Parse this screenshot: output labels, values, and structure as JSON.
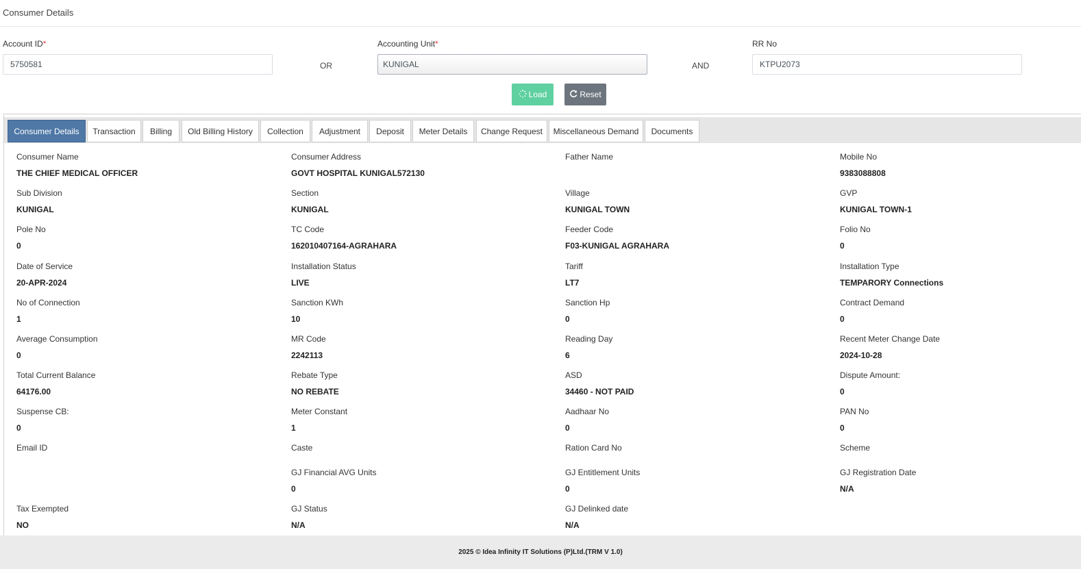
{
  "page": {
    "title": "Consumer Details"
  },
  "search": {
    "account_id": {
      "label": "Account ID",
      "required_mark": "*",
      "value": "5750581"
    },
    "or_label": "OR",
    "accounting_unit": {
      "label": "Accounting Unit",
      "required_mark": "*",
      "value": "KUNIGAL"
    },
    "and_label": "AND",
    "rr_no": {
      "label": "RR No",
      "value": "KTPU2073"
    }
  },
  "buttons": {
    "load": {
      "label": "Load",
      "icon": "spinner-icon",
      "color": "#5fd0a0"
    },
    "reset": {
      "label": "Reset",
      "icon": "refresh-icon",
      "color": "#6c757d"
    }
  },
  "tabs": [
    {
      "label": "Consumer Details",
      "active": true
    },
    {
      "label": "Transaction"
    },
    {
      "label": "Billing"
    },
    {
      "label": "Old Billing History"
    },
    {
      "label": "Collection"
    },
    {
      "label": "Adjustment"
    },
    {
      "label": "Deposit"
    },
    {
      "label": "Meter Details"
    },
    {
      "label": "Change Request"
    },
    {
      "label": "Miscellaneous Demand"
    },
    {
      "label": "Documents"
    }
  ],
  "details": [
    [
      {
        "label": "Consumer Name",
        "value": "THE CHIEF MEDICAL OFFICER"
      },
      {
        "label": "Consumer Address",
        "value": "GOVT HOSPITAL KUNIGAL572130"
      },
      {
        "label": "Father Name",
        "value": ""
      },
      {
        "label": "Mobile No",
        "value": "9383088808"
      }
    ],
    [
      {
        "label": "Sub Division",
        "value": "KUNIGAL"
      },
      {
        "label": "Section",
        "value": "KUNIGAL"
      },
      {
        "label": "Village",
        "value": "KUNIGAL TOWN"
      },
      {
        "label": "GVP",
        "value": "KUNIGAL TOWN-1"
      }
    ],
    [
      {
        "label": "Pole No",
        "value": "0"
      },
      {
        "label": "TC Code",
        "value": "162010407164-AGRAHARA"
      },
      {
        "label": "Feeder Code",
        "value": "F03-KUNIGAL AGRAHARA"
      },
      {
        "label": "Folio No",
        "value": "0"
      }
    ],
    [
      {
        "label": "Date of Service",
        "value": "20-APR-2024"
      },
      {
        "label": "Installation Status",
        "value": "LIVE"
      },
      {
        "label": "Tariff",
        "value": "LT7"
      },
      {
        "label": "Installation Type",
        "value": "TEMPARORY Connections"
      }
    ],
    [
      {
        "label": "No of Connection",
        "value": "1"
      },
      {
        "label": "Sanction KWh",
        "value": "10"
      },
      {
        "label": "Sanction Hp",
        "value": "0"
      },
      {
        "label": "Contract Demand",
        "value": "0"
      }
    ],
    [
      {
        "label": "Average Consumption",
        "value": "0"
      },
      {
        "label": "MR Code",
        "value": "2242113"
      },
      {
        "label": "Reading Day",
        "value": "6"
      },
      {
        "label": "Recent Meter Change Date",
        "value": "2024-10-28"
      }
    ],
    [
      {
        "label": "Total Current Balance",
        "value": "64176.00"
      },
      {
        "label": "Rebate Type",
        "value": "NO REBATE"
      },
      {
        "label": "ASD",
        "value": "34460 - NOT PAID"
      },
      {
        "label": "Dispute Amount:",
        "value": "0"
      }
    ],
    [
      {
        "label": "Suspense CB:",
        "value": "0"
      },
      {
        "label": "Meter Constant",
        "value": "1"
      },
      {
        "label": "Aadhaar No",
        "value": "0"
      },
      {
        "label": "PAN No",
        "value": "0"
      }
    ],
    [
      {
        "label": "Email ID",
        "value": ""
      },
      {
        "label": "Caste",
        "value": ""
      },
      {
        "label": "Ration Card No",
        "value": ""
      },
      {
        "label": "Scheme",
        "value": ""
      }
    ],
    [
      null,
      {
        "label": "GJ Financial AVG Units",
        "value": "0"
      },
      {
        "label": "GJ Entitlement Units",
        "value": "0"
      },
      {
        "label": "GJ Registration Date",
        "value": "N/A"
      }
    ],
    [
      {
        "label": "Tax Exempted",
        "value": "NO"
      },
      {
        "label": "GJ Status",
        "value": "N/A"
      },
      {
        "label": "GJ Delinked date",
        "value": "N/A"
      },
      null
    ]
  ],
  "footer": {
    "text": "2025 © Idea Infinity IT Solutions (P)Ltd.(TRM V 1.0)"
  }
}
